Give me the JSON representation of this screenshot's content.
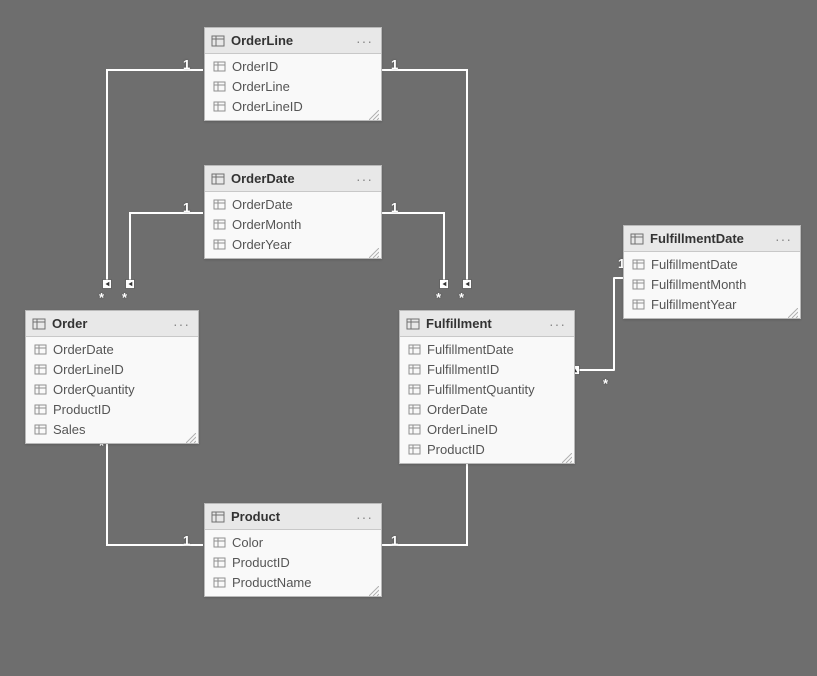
{
  "tables": {
    "orderline": {
      "title": "OrderLine",
      "fields": [
        "OrderID",
        "OrderLine",
        "OrderLineID"
      ]
    },
    "orderdate": {
      "title": "OrderDate",
      "fields": [
        "OrderDate",
        "OrderMonth",
        "OrderYear"
      ]
    },
    "order": {
      "title": "Order",
      "fields": [
        "OrderDate",
        "OrderLineID",
        "OrderQuantity",
        "ProductID",
        "Sales"
      ]
    },
    "fulfillment": {
      "title": "Fulfillment",
      "fields": [
        "FulfillmentDate",
        "FulfillmentID",
        "FulfillmentQuantity",
        "OrderDate",
        "OrderLineID",
        "ProductID"
      ]
    },
    "fulfillmentdate": {
      "title": "FulfillmentDate",
      "fields": [
        "FulfillmentDate",
        "FulfillmentMonth",
        "FulfillmentYear"
      ]
    },
    "product": {
      "title": "Product",
      "fields": [
        "Color",
        "ProductID",
        "ProductName"
      ]
    }
  },
  "cardinality": {
    "one": "1",
    "many": "*"
  },
  "menu_label": "···"
}
